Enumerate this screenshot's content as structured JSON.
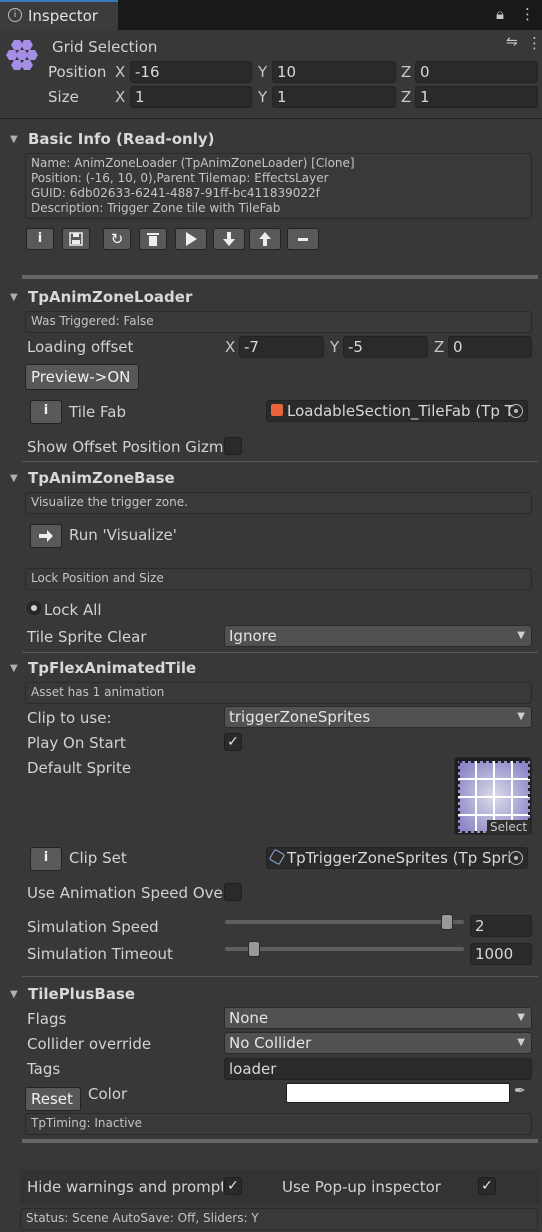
{
  "window": {
    "tab_title": "Inspector",
    "lock_icon": "lock-icon",
    "menu_icon": "kebab-menu-icon"
  },
  "grid_selection": {
    "title": "Grid Selection",
    "position_label": "Position",
    "size_label": "Size",
    "position": {
      "x": "-16",
      "y": "10",
      "z": "0"
    },
    "size": {
      "x": "1",
      "y": "1",
      "z": "1"
    },
    "axes": {
      "x": "X",
      "y": "Y",
      "z": "Z"
    }
  },
  "basic_info": {
    "title": "Basic Info (Read-only)",
    "lines": [
      "Name: AnimZoneLoader (TpAnimZoneLoader) [Clone]",
      "Position: (-16, 10, 0),Parent Tilemap: EffectsLayer",
      "GUID: 6db02633-6241-4887-91ff-bc411839022f",
      "Description: Trigger Zone tile with TileFab"
    ],
    "toolbar_icons": [
      "info-icon",
      "save-icon",
      "refresh-icon",
      "delete-icon",
      "play-icon",
      "down-arrow-icon",
      "up-arrow-icon",
      "minus-icon"
    ]
  },
  "anim_zone_loader": {
    "title": "TpAnimZoneLoader",
    "was_triggered": "Was Triggered: False",
    "loading_offset_label": "Loading offset",
    "loading_offset": {
      "x": "-7",
      "y": "-5",
      "z": "0"
    },
    "preview_button": "Preview->ON",
    "tile_fab_label": "Tile Fab",
    "tile_fab_value": "LoadableSection_TileFab (Tp T",
    "show_offset_label": "Show Offset Position Gizmo",
    "show_offset_checked": false
  },
  "anim_zone_base": {
    "title": "TpAnimZoneBase",
    "visualize_help": "Visualize the trigger zone.",
    "run_label": "Run 'Visualize'",
    "lock_help": "Lock Position and Size",
    "lock_all_label": "Lock All",
    "tile_sprite_clear_label": "Tile Sprite Clear",
    "tile_sprite_clear_value": "Ignore"
  },
  "flex_animated": {
    "title": "TpFlexAnimatedTile",
    "asset_help": "Asset has 1 animation",
    "clip_label": "Clip to use:",
    "clip_value": "triggerZoneSprites",
    "play_on_start_label": "Play On Start",
    "play_on_start_checked": true,
    "default_sprite_label": "Default Sprite",
    "select_label": "Select",
    "clip_set_label": "Clip Set",
    "clip_set_value": "TpTriggerZoneSprites (Tp Spri",
    "use_anim_speed_label": "Use Animation Speed Override",
    "use_anim_speed_checked": false,
    "sim_speed_label": "Simulation Speed",
    "sim_speed_value": "2",
    "sim_speed_fraction": 0.95,
    "sim_timeout_label": "Simulation Timeout",
    "sim_timeout_value": "1000",
    "sim_timeout_fraction": 0.1
  },
  "tileplus_base": {
    "title": "TilePlusBase",
    "flags_label": "Flags",
    "flags_value": "None",
    "collider_label": "Collider override",
    "collider_value": "No Collider",
    "tags_label": "Tags",
    "tags_value": "loader",
    "reset_button": "Reset",
    "color_label": "Color",
    "color_value": "#ffffff",
    "timing_help": "TpTiming: Inactive"
  },
  "footer": {
    "hide_warnings_label": "Hide warnings and prompts",
    "hide_warnings_checked": true,
    "popup_label": "Use Pop-up inspector",
    "popup_checked": true,
    "status": "Status: Scene AutoSave: Off, Sliders: Y"
  }
}
